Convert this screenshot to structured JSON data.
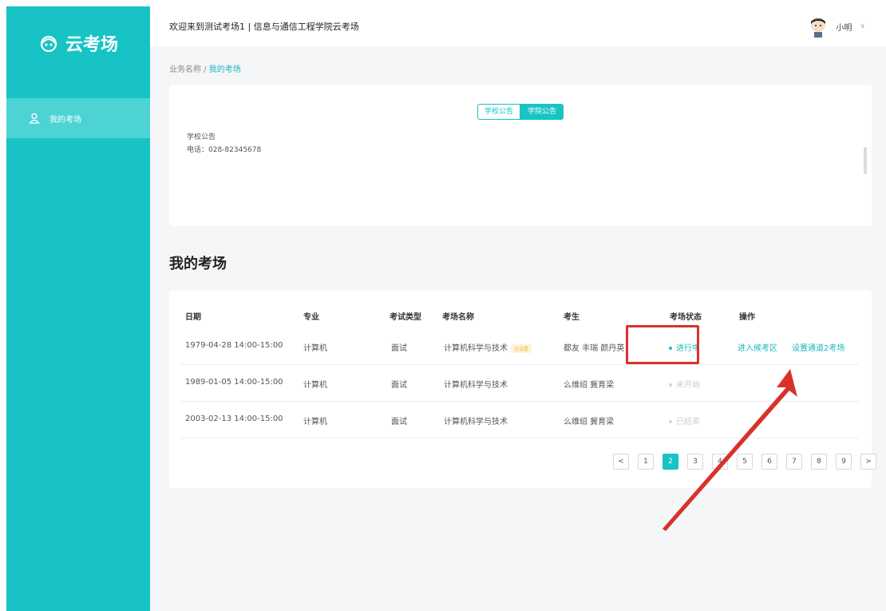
{
  "app": {
    "logo_text": "云考场"
  },
  "sidebar": {
    "items": [
      {
        "label": "我的考场"
      }
    ]
  },
  "topbar": {
    "welcome": "欢迎来到测试考场1 | 信息与通信工程学院云考场",
    "user_name": "小明"
  },
  "breadcrumb": {
    "parent": "业务名称",
    "separator": " / ",
    "current": "我的考场"
  },
  "notice": {
    "tabs": [
      {
        "label": "学校公告",
        "active": false
      },
      {
        "label": "学院公告",
        "active": true
      }
    ],
    "lines": [
      "学校公告",
      "电话：028-82345678"
    ]
  },
  "section": {
    "title": "我的考场"
  },
  "table": {
    "headers": [
      "日期",
      "专业",
      "考试类型",
      "考场名称",
      "考生",
      "考场状态",
      "操作"
    ],
    "rows": [
      {
        "date": "1979-04-28 14:00-15:00",
        "major": "计算机",
        "type": "面试",
        "name": "计算机科学与技术",
        "badge": "已设置",
        "students": "都友 丰瑞 颜丹英",
        "status": "进行中",
        "action1": "进入候考区",
        "action2": "设置通道2考场"
      },
      {
        "date": "1989-01-05 14:00-15:00",
        "major": "计算机",
        "type": "面试",
        "name": "计算机科学与技术",
        "badge": "",
        "students": "么维绍 冀育梁",
        "status": "未开始",
        "action1": "",
        "action2": ""
      },
      {
        "date": "2003-02-13 14:00-15:00",
        "major": "计算机",
        "type": "面试",
        "name": "计算机科学与技术",
        "badge": "",
        "students": "么维绍 冀育梁",
        "status": "已结束",
        "action1": "",
        "action2": ""
      }
    ]
  },
  "pagination": {
    "prev": "<",
    "next": ">",
    "pages": [
      "1",
      "2",
      "3",
      "4",
      "5",
      "6",
      "7",
      "8",
      "9"
    ],
    "current": "2"
  },
  "colors": {
    "primary": "#17c3c5",
    "sidebar_active": "#4dd3d4",
    "annotation_red": "#d9312b"
  },
  "icons": {
    "logo": "cloud-hat-icon",
    "nav": "user-outline-icon",
    "dropdown": "chevron-down-icon"
  }
}
